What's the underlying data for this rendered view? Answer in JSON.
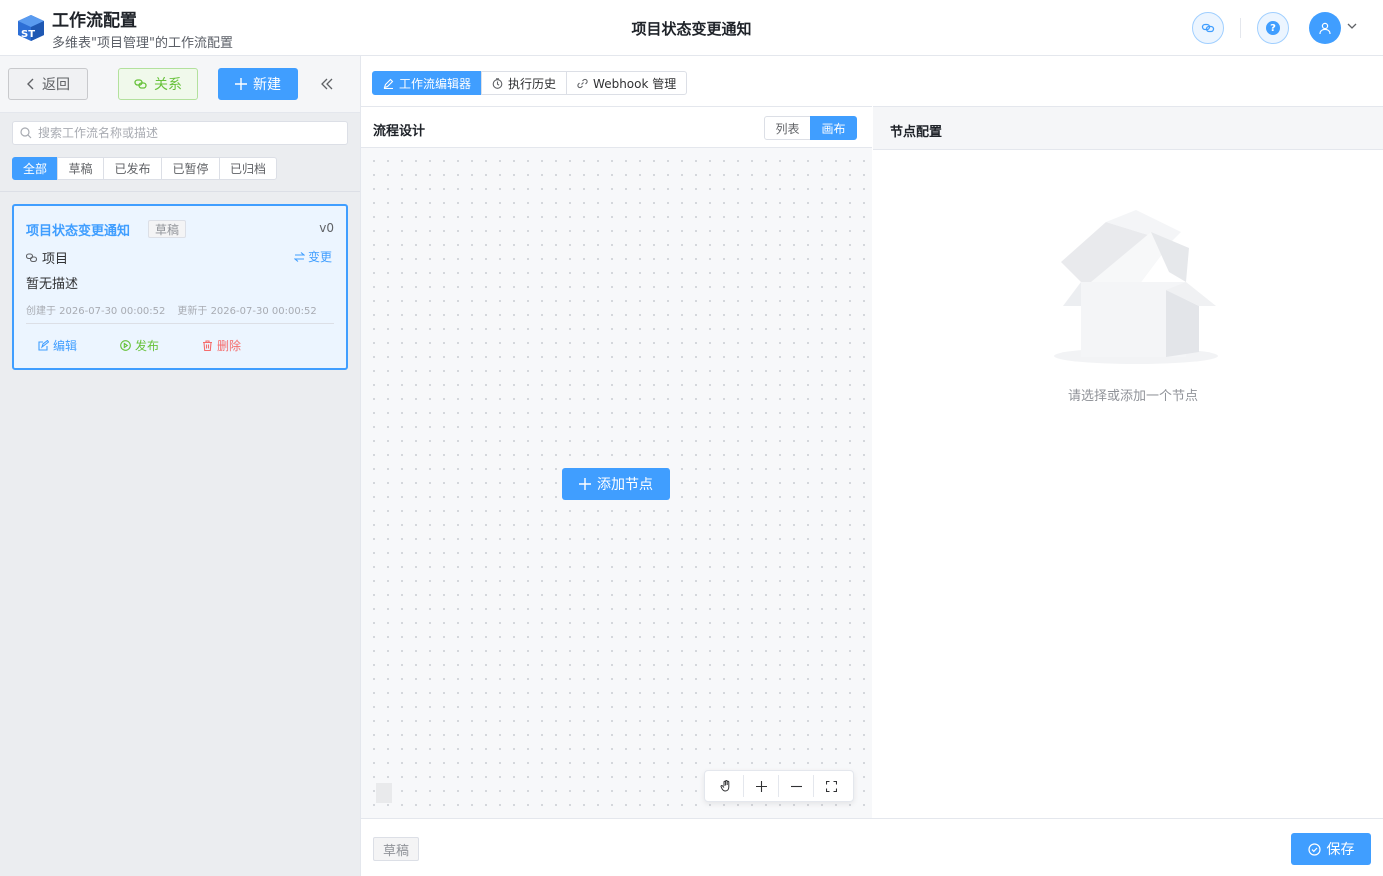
{
  "header": {
    "app_title": "工作流配置",
    "app_subtitle": "多维表\"项目管理\"的工作流配置",
    "page_title": "项目状态变更通知",
    "logo_text": "ST"
  },
  "sidebar": {
    "back_label": "返回",
    "relation_label": "关系",
    "new_label": "新建",
    "search_placeholder": "搜索工作流名称或描述",
    "search_value": "",
    "filters": [
      "全部",
      "草稿",
      "已发布",
      "已暂停",
      "已归档"
    ],
    "active_filter": "全部",
    "workflow": {
      "name": "项目状态变更通知",
      "status": "草稿",
      "version": "v0",
      "table": "项目",
      "change_label": "变更",
      "description": "暂无描述",
      "created": "创建于 2026-07-30 00:00:52",
      "updated": "更新于 2026-07-30 00:00:52",
      "edit_label": "编辑",
      "publish_label": "发布",
      "delete_label": "删除"
    }
  },
  "tabs": [
    "工作流编辑器",
    "执行历史",
    "Webhook 管理"
  ],
  "active_tab": "工作流编辑器",
  "design": {
    "title": "流程设计",
    "view_list": "列表",
    "view_canvas": "画布",
    "active_view": "画布",
    "add_node_label": "添加节点"
  },
  "node_config": {
    "title": "节点配置",
    "empty_text": "请选择或添加一个节点"
  },
  "footer": {
    "status": "草稿",
    "save_label": "保存"
  },
  "colors": {
    "primary": "#409eff",
    "success": "#67c23a",
    "danger": "#f56c6c",
    "info": "#909399"
  }
}
